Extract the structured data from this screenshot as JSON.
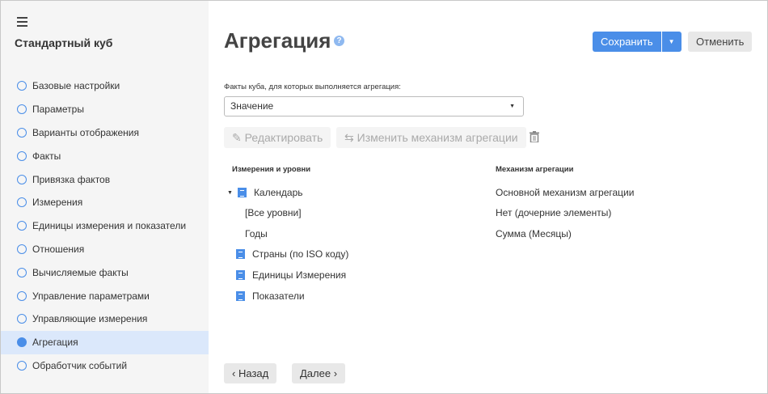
{
  "sidebar": {
    "title": "Стандартный куб",
    "items": [
      {
        "label": "Базовые настройки"
      },
      {
        "label": "Параметры"
      },
      {
        "label": "Варианты отображения"
      },
      {
        "label": "Факты"
      },
      {
        "label": "Привязка фактов"
      },
      {
        "label": "Измерения"
      },
      {
        "label": "Единицы измерения и показатели"
      },
      {
        "label": "Отношения"
      },
      {
        "label": "Вычисляемые факты"
      },
      {
        "label": "Управление параметрами"
      },
      {
        "label": "Управляющие измерения"
      },
      {
        "label": "Агрегация"
      },
      {
        "label": "Обработчик событий"
      }
    ],
    "active": "Агрегация"
  },
  "header": {
    "title": "Агрегация",
    "help": "?",
    "save": "Сохранить",
    "cancel": "Отменить"
  },
  "facts": {
    "label": "Факты куба, для которых выполняется агрегация:",
    "value": "Значение"
  },
  "toolbar": {
    "edit": "Редактировать",
    "change": "Изменить механизм агрегации"
  },
  "table": {
    "col1": "Измерения и уровни",
    "col2": "Механизм агрегации",
    "rows": [
      {
        "name": "Календарь",
        "mech": "Основной механизм агрегации"
      },
      {
        "name": "[Все уровни]",
        "mech": "Нет (дочерние элементы)"
      },
      {
        "name": "Годы",
        "mech": "Сумма (Месяцы)"
      },
      {
        "name": "Страны (по ISO коду)"
      },
      {
        "name": "Единицы Измерения"
      },
      {
        "name": "Показатели"
      }
    ]
  },
  "nav": {
    "back": "Назад",
    "next": "Далее"
  },
  "colors": {
    "accent": "#4a8ee8",
    "active_bg": "#dbe8fb"
  }
}
